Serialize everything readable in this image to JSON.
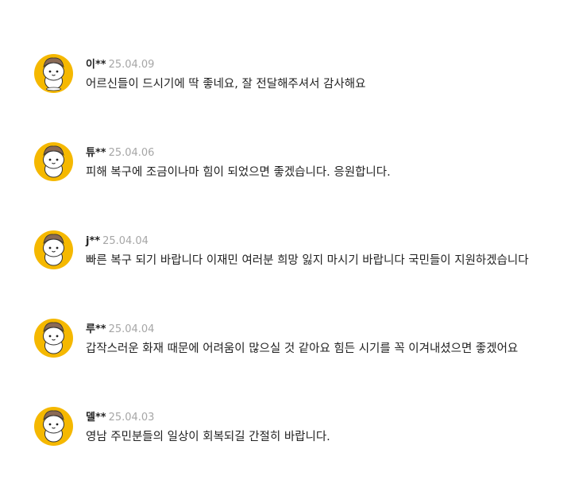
{
  "comments": [
    {
      "author": "이**",
      "date": "25.04.09",
      "text": "어르신들이 드시기에 딱 좋네요, 잘 전달해주셔서 감사해요"
    },
    {
      "author": "튜**",
      "date": "25.04.06",
      "text": "피해 복구에 조금이나마 힘이 되었으면 좋겠습니다. 응원합니다."
    },
    {
      "author": "j**",
      "date": "25.04.04",
      "text": "빠른 복구 되기 바랍니다 이재민 여러분 희망 잃지 마시기 바랍니다 국민들이 지원하겠습니다"
    },
    {
      "author": "루**",
      "date": "25.04.04",
      "text": "갑작스러운 화재 때문에 어려움이 많으실 것 같아요 힘든 시기를 꼭 이겨내셨으면 좋겠어요"
    },
    {
      "author": "델**",
      "date": "25.04.03",
      "text": "영남 주민분들의 일상이 회복되길 간절히 바랍니다."
    }
  ],
  "colors": {
    "avatar_bg": "#f5b800",
    "date": "#a6a6a6",
    "text": "#222222"
  },
  "icons": {
    "avatar": "character-avatar-icon"
  }
}
